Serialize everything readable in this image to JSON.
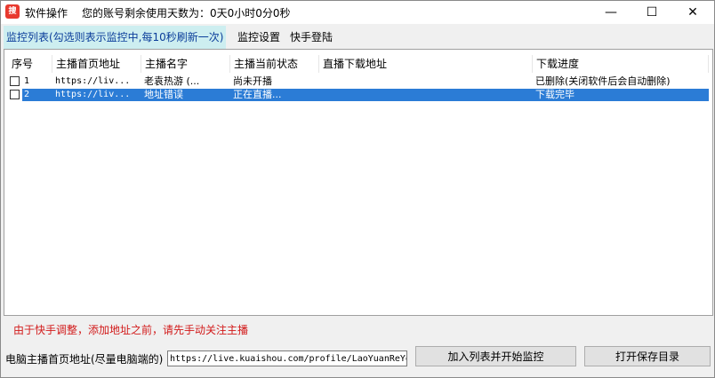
{
  "titlebar": {
    "app_icon_label": "搜",
    "title": "软件操作",
    "remaining_days": "您的账号剩余使用天数为：0天0小时0分0秒",
    "minimize": "—",
    "maximize": "☐",
    "close": "✕"
  },
  "tabs": [
    {
      "label": "监控列表(勾选则表示监控中,每10秒刷新一次)",
      "active": true
    },
    {
      "label": "监控设置",
      "active": false
    },
    {
      "label": "快手登陆",
      "active": false
    }
  ],
  "table": {
    "columns": [
      "序号",
      "主播首页地址",
      "主播名字",
      "主播当前状态",
      "直播下载地址",
      "下载进度"
    ],
    "rows": [
      {
        "index": "1",
        "url": "https://liv...",
        "name": "老袁热游 (...",
        "status": "尚未开播",
        "download_url": "",
        "progress": "已删除(关闭软件后会自动删除)",
        "checked": false,
        "selected": false
      },
      {
        "index": "2",
        "url": "https://liv...",
        "name": "地址错误",
        "status": "正在直播...",
        "download_url": "",
        "progress": "下载完毕",
        "checked": false,
        "selected": true
      }
    ]
  },
  "notice": "由于快手调整，添加地址之前，请先手动关注主播",
  "address": {
    "label": "电脑主播首页地址(尽量电脑端的)",
    "value": "https://live.kuaishou.com/profile/LaoYuanReYo"
  },
  "buttons": {
    "add_and_monitor": "加入列表并开始监控",
    "open_save_dir": "打开保存目录"
  },
  "colors": {
    "selected_row": "#2b7cd6",
    "active_tab": "#cdeef0",
    "notice_text": "#d21a1a",
    "app_icon": "#e8392e"
  }
}
